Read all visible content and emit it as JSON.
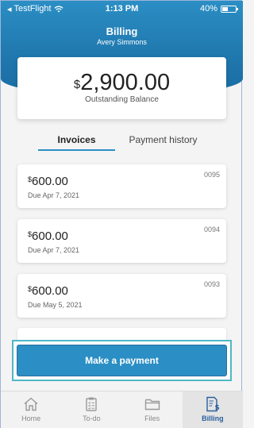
{
  "status_bar": {
    "carrier": "TestFlight",
    "time": "1:13 PM",
    "battery": "40%"
  },
  "header": {
    "title": "Billing",
    "subtitle": "Avery Simmons"
  },
  "balance": {
    "currency": "$",
    "amount": "2,900.00",
    "label": "Outstanding Balance"
  },
  "tabs": [
    {
      "label": "Invoices",
      "active": true
    },
    {
      "label": "Payment history",
      "active": false
    }
  ],
  "invoices": [
    {
      "currency": "$",
      "amount": "600.00",
      "due": "Due Apr 7, 2021",
      "number": "0095"
    },
    {
      "currency": "$",
      "amount": "600.00",
      "due": "Due Apr 7, 2021",
      "number": "0094"
    },
    {
      "currency": "$",
      "amount": "600.00",
      "due": "Due May 5, 2021",
      "number": "0093"
    }
  ],
  "payment_button": {
    "label": "Make a payment"
  },
  "nav": [
    {
      "label": "Home",
      "icon": "home-icon",
      "active": false
    },
    {
      "label": "To-do",
      "icon": "clipboard-icon",
      "active": false
    },
    {
      "label": "Files",
      "icon": "folder-icon",
      "active": false
    },
    {
      "label": "Billing",
      "icon": "bill-icon",
      "active": true
    }
  ],
  "colors": {
    "accent": "#2b8ec4",
    "active_nav": "#2a5f9e",
    "highlight_border": "#4fb8c6"
  }
}
